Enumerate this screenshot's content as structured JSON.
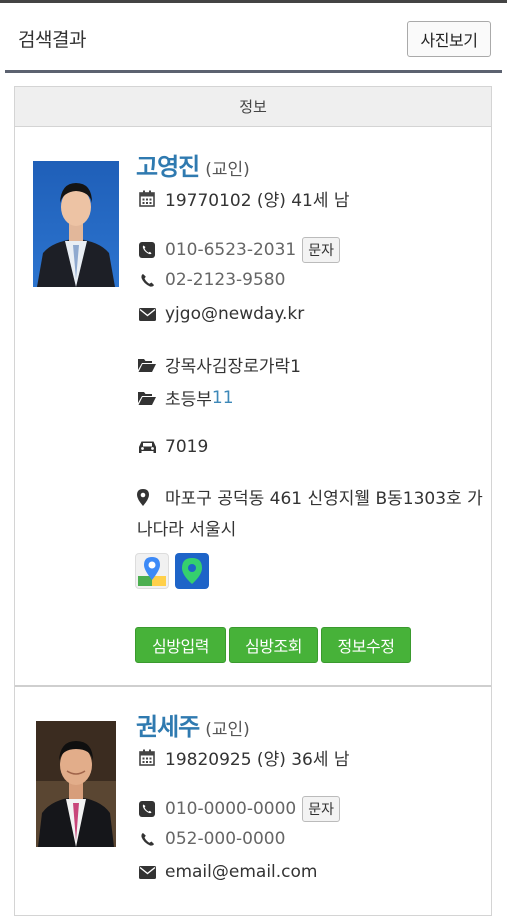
{
  "header": {
    "title": "검색결과",
    "photo_view_label": "사진보기"
  },
  "panel": {
    "heading": "정보"
  },
  "people": [
    {
      "name": "고영진",
      "role": "(교인)",
      "birth": "19770102 (양) 41세 남",
      "mobile": "010-6523-2031",
      "sms_label": "문자",
      "phone": "02-2123-9580",
      "email": "yjgo@newday.kr",
      "group1": "강목사김장로가락1",
      "group2_prefix": "초등부",
      "group2_link": "11",
      "car": "7019",
      "address": "마포구 공덕동 461 신영지웰 B동1303호 가나다라 서울시",
      "buttons": [
        "심방입력",
        "심방조회",
        "정보수정"
      ]
    },
    {
      "name": "권세주",
      "role": "(교인)",
      "birth": "19820925 (양) 36세 남",
      "mobile": "010-0000-0000",
      "sms_label": "문자",
      "phone": "052-000-0000",
      "email": "email@email.com"
    }
  ],
  "icons": {
    "calendar": "calendar-icon",
    "mobile": "mobile-phone-icon",
    "phone": "phone-icon",
    "email": "envelope-icon",
    "folder": "folder-open-icon",
    "car": "car-icon",
    "location": "map-marker-icon",
    "google_maps": "google-maps-icon",
    "naver_map": "naver-map-icon"
  },
  "colors": {
    "name": "#2f7ab0",
    "button_green": "#47b239",
    "header_rule": "#5c6270"
  }
}
